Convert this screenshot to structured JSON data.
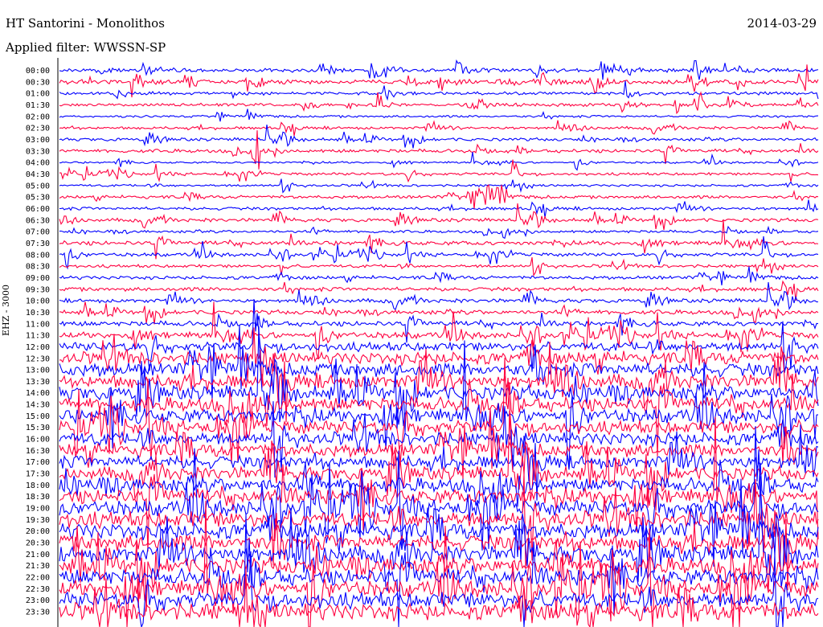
{
  "header": {
    "station": "HT Santorini - Monolithos",
    "date": "2014-03-29",
    "filter_prefix": "Applied filter:",
    "filter_name": "WWSSN-SP"
  },
  "chart_data": {
    "type": "line",
    "title": "HT Santorini - Monolithos",
    "date": "2014-03-29",
    "filter": "WWSSN-SP",
    "ylabel": "EHZ - 3000",
    "y_tick_labels": [
      "00:00",
      "00:30",
      "01:00",
      "01:30",
      "02:00",
      "02:30",
      "03:00",
      "03:30",
      "04:00",
      "04:30",
      "05:00",
      "05:30",
      "06:00",
      "06:30",
      "07:00",
      "07:30",
      "08:00",
      "08:30",
      "09:00",
      "09:30",
      "10:00",
      "10:30",
      "11:00",
      "11:30",
      "12:00",
      "12:30",
      "13:00",
      "13:30",
      "14:00",
      "14:30",
      "15:00",
      "15:30",
      "16:00",
      "16:30",
      "17:00",
      "17:30",
      "18:00",
      "18:30",
      "19:00",
      "19:30",
      "20:00",
      "20:30",
      "21:00",
      "21:30",
      "22:00",
      "22:30",
      "23:00",
      "23:30"
    ],
    "trace_colors": [
      "#0000ff",
      "#ff0040"
    ],
    "relative_amplitude": [
      1.0,
      1.1,
      0.8,
      0.8,
      0.6,
      0.7,
      0.8,
      0.9,
      0.5,
      0.7,
      0.6,
      0.8,
      0.8,
      0.9,
      0.7,
      1.1,
      0.9,
      0.8,
      0.9,
      1.0,
      1.0,
      1.1,
      1.3,
      1.6,
      2.3,
      3.2,
      3.6,
      3.6,
      3.6,
      3.6,
      3.6,
      3.4,
      3.4,
      3.4,
      3.4,
      3.4,
      3.6,
      3.8,
      4.0,
      4.2,
      4.2,
      4.2,
      4.2,
      4.2,
      4.2,
      4.2,
      4.2,
      4.4
    ],
    "events": [
      {
        "time": "03:30",
        "description": "sharp spike"
      },
      {
        "time": "05:30",
        "description": "local earthquake"
      }
    ]
  }
}
